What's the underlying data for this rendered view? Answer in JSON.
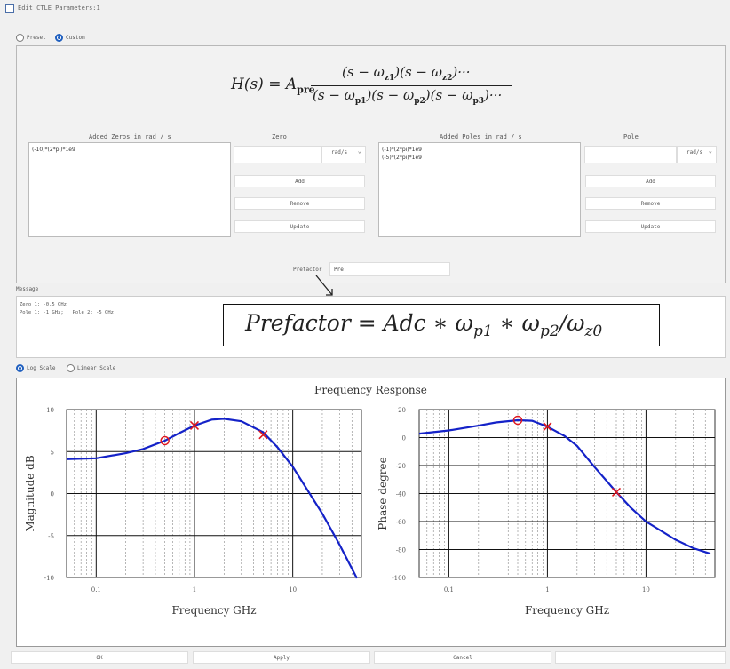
{
  "window": {
    "title": "Edit CTLE Parameters:1"
  },
  "mode": {
    "preset_label": "Preset",
    "custom_label": "Custom",
    "selected": "custom"
  },
  "transfer_function": {
    "lhs": "H(s) = A",
    "sub": "pre",
    "numerator": "(s − ω",
    "num_rest": "z1)(s − ωz2)···",
    "denominator": "(s − ωp1)(s − ωp2)(s − ωp3)···"
  },
  "zeros": {
    "list_label": "Added Zeros in rad / s",
    "items": [
      "(-10)*(2*pi)*1e9"
    ],
    "input_label": "Zero",
    "unit": "rad/s",
    "add": "Add",
    "remove": "Remove",
    "update": "Update"
  },
  "poles": {
    "list_label": "Added Poles in rad / s",
    "items": [
      "(-1)*(2*pi)*1e9",
      "(-5)*(2*pi)*1e9"
    ],
    "input_label": "Pole",
    "unit": "rad/s",
    "add": "Add",
    "remove": "Remove",
    "update": "Update"
  },
  "prefactor": {
    "label": "Prefactor",
    "value": "Pre"
  },
  "message": {
    "label": "Message",
    "line1": "Zero 1: -0.5 GHz",
    "line2": "Pole 1: -1 GHz;   Pole 2: -5 GHz"
  },
  "annotation": {
    "text": "Prefactor = Adc * ωp1 * ωp2/ωz0"
  },
  "scale": {
    "log_label": "Log Scale",
    "linear_label": "Linear Scale",
    "selected": "log"
  },
  "plot_title": "Frequency Response",
  "chart_data": [
    {
      "type": "line",
      "title": "",
      "xlabel": "Frequency   GHz",
      "ylabel": "Magnitude   dB",
      "x_scale": "log",
      "xlim": [
        0.05,
        50
      ],
      "ylim": [
        -10,
        10
      ],
      "x_ticks": [
        "0.1",
        "1",
        "10"
      ],
      "y_ticks": [
        "10",
        "5",
        "0",
        "-5",
        "-10"
      ],
      "grid": true,
      "series": [
        {
          "x": [
            0.05,
            0.1,
            0.2,
            0.3,
            0.5,
            0.7,
            1,
            1.5,
            2,
            3,
            5,
            7,
            10,
            20,
            30,
            45
          ],
          "y": [
            4.1,
            4.2,
            4.8,
            5.3,
            6.3,
            7.2,
            8.1,
            8.8,
            8.9,
            8.6,
            7.3,
            5.5,
            3.2,
            -2.4,
            -6.1,
            -10.1
          ]
        }
      ],
      "markers": [
        {
          "x": 0.5,
          "y": 6.3,
          "kind": "zero"
        },
        {
          "x": 1,
          "y": 8.1,
          "kind": "pole"
        },
        {
          "x": 5,
          "y": 7,
          "kind": "pole"
        }
      ]
    },
    {
      "type": "line",
      "title": "",
      "xlabel": "Frequency   GHz",
      "ylabel": "Phase   degree",
      "x_scale": "log",
      "xlim": [
        0.05,
        50
      ],
      "ylim": [
        -100,
        20
      ],
      "x_ticks": [
        "0.1",
        "1",
        "10"
      ],
      "y_ticks": [
        "20",
        "0",
        "-20",
        "-40",
        "-60",
        "-80",
        "-100"
      ],
      "grid": true,
      "series": [
        {
          "x": [
            0.05,
            0.1,
            0.2,
            0.3,
            0.5,
            0.7,
            1,
            1.5,
            2,
            3,
            5,
            7,
            10,
            20,
            30,
            45
          ],
          "y": [
            2.8,
            5.1,
            8.5,
            10.8,
            12.4,
            12,
            7.8,
            1,
            -6,
            -21,
            -39,
            -50,
            -60,
            -73,
            -79,
            -83
          ]
        }
      ],
      "markers": [
        {
          "x": 0.5,
          "y": 12.4,
          "kind": "zero"
        },
        {
          "x": 1,
          "y": 7.8,
          "kind": "pole"
        },
        {
          "x": 5,
          "y": -39,
          "kind": "pole"
        }
      ]
    }
  ],
  "footer": {
    "ok": "OK",
    "apply": "Apply",
    "cancel": "Cancel"
  }
}
